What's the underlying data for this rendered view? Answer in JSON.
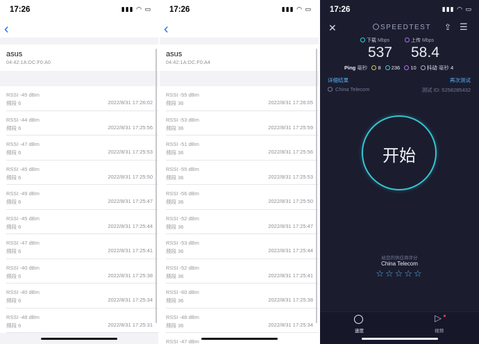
{
  "screen1": {
    "status_time": "17:26",
    "device_name": "asus",
    "device_mac": "04:42:1A:DC:F0:A0",
    "records": [
      {
        "rssi": "RSSI -45 dBm",
        "band": "频段 6",
        "time": "2022/8/31 17:26:02"
      },
      {
        "rssi": "RSSI -44 dBm",
        "band": "频段 6",
        "time": "2022/8/31 17:25:56"
      },
      {
        "rssi": "RSSI -47 dBm",
        "band": "频段 6",
        "time": "2022/8/31 17:25:53"
      },
      {
        "rssi": "RSSI -45 dBm",
        "band": "频段 6",
        "time": "2022/8/31 17:25:50"
      },
      {
        "rssi": "RSSI -49 dBm",
        "band": "频段 6",
        "time": "2022/8/31 17:25:47"
      },
      {
        "rssi": "RSSI -45 dBm",
        "band": "频段 6",
        "time": "2022/8/31 17:25:44"
      },
      {
        "rssi": "RSSI -47 dBm",
        "band": "频段 6",
        "time": "2022/8/31 17:25:41"
      },
      {
        "rssi": "RSSI -40 dBm",
        "band": "频段 6",
        "time": "2022/8/31 17:25:38"
      },
      {
        "rssi": "RSSI -40 dBm",
        "band": "频段 6",
        "time": "2022/8/31 17:25:34"
      },
      {
        "rssi": "RSSI -48 dBm",
        "band": "频段 6",
        "time": "2022/8/31 17:25:31"
      }
    ]
  },
  "screen2": {
    "status_time": "17:26",
    "device_name": "asus",
    "device_mac": "04:42:1A:DC:F0:A4",
    "records": [
      {
        "rssi": "RSSI -55 dBm",
        "band": "频段 36",
        "time": "2022/8/31 17:26:05"
      },
      {
        "rssi": "RSSI -53 dBm",
        "band": "频段 36",
        "time": "2022/8/31 17:25:59"
      },
      {
        "rssi": "RSSI -51 dBm",
        "band": "频段 36",
        "time": "2022/8/31 17:25:56"
      },
      {
        "rssi": "RSSI -55 dBm",
        "band": "频段 36",
        "time": "2022/8/31 17:25:53"
      },
      {
        "rssi": "RSSI -56 dBm",
        "band": "频段 36",
        "time": "2022/8/31 17:25:50"
      },
      {
        "rssi": "RSSI -52 dBm",
        "band": "频段 36",
        "time": "2022/8/31 17:25:47"
      },
      {
        "rssi": "RSSI -53 dBm",
        "band": "频段 36",
        "time": "2022/8/31 17:25:44"
      },
      {
        "rssi": "RSSI -52 dBm",
        "band": "频段 36",
        "time": "2022/8/31 17:25:41"
      },
      {
        "rssi": "RSSI -60 dBm",
        "band": "频段 36",
        "time": "2022/8/31 17:25:38"
      },
      {
        "rssi": "RSSI -48 dBm",
        "band": "频段 36",
        "time": "2022/8/31 17:25:34"
      },
      {
        "rssi": "RSSI -47 dBm",
        "band": "",
        "time": ""
      }
    ]
  },
  "screen3": {
    "status_time": "17:26",
    "logo_text": "SPEEDTEST",
    "download": {
      "label": "下载",
      "unit": "Mbps",
      "value": "537"
    },
    "upload": {
      "label": "上传",
      "unit": "Mbps",
      "value": "58.4"
    },
    "ping": {
      "label": "Ping",
      "unit": "毫秒",
      "idle": "8",
      "download": "236",
      "upload": "10",
      "jitter_label": "抖动",
      "jitter_unit": "毫秒",
      "jitter": "4"
    },
    "detail_link": "详细结果",
    "retest_link": "再次测试",
    "isp": "China Telecom",
    "test_id": "测试 ID: 5258285432",
    "go_label": "开始",
    "rating_prompt": "给您的供应商评分",
    "rating_isp": "China Telecom",
    "stars": "☆☆☆☆☆",
    "tabs": {
      "speed": "速度",
      "video": "视频"
    },
    "colors": {
      "accent_cyan": "#35c6d2",
      "accent_purple": "#b56ee8",
      "link_blue": "#5aaef0",
      "background": "#1b1d2f"
    }
  }
}
